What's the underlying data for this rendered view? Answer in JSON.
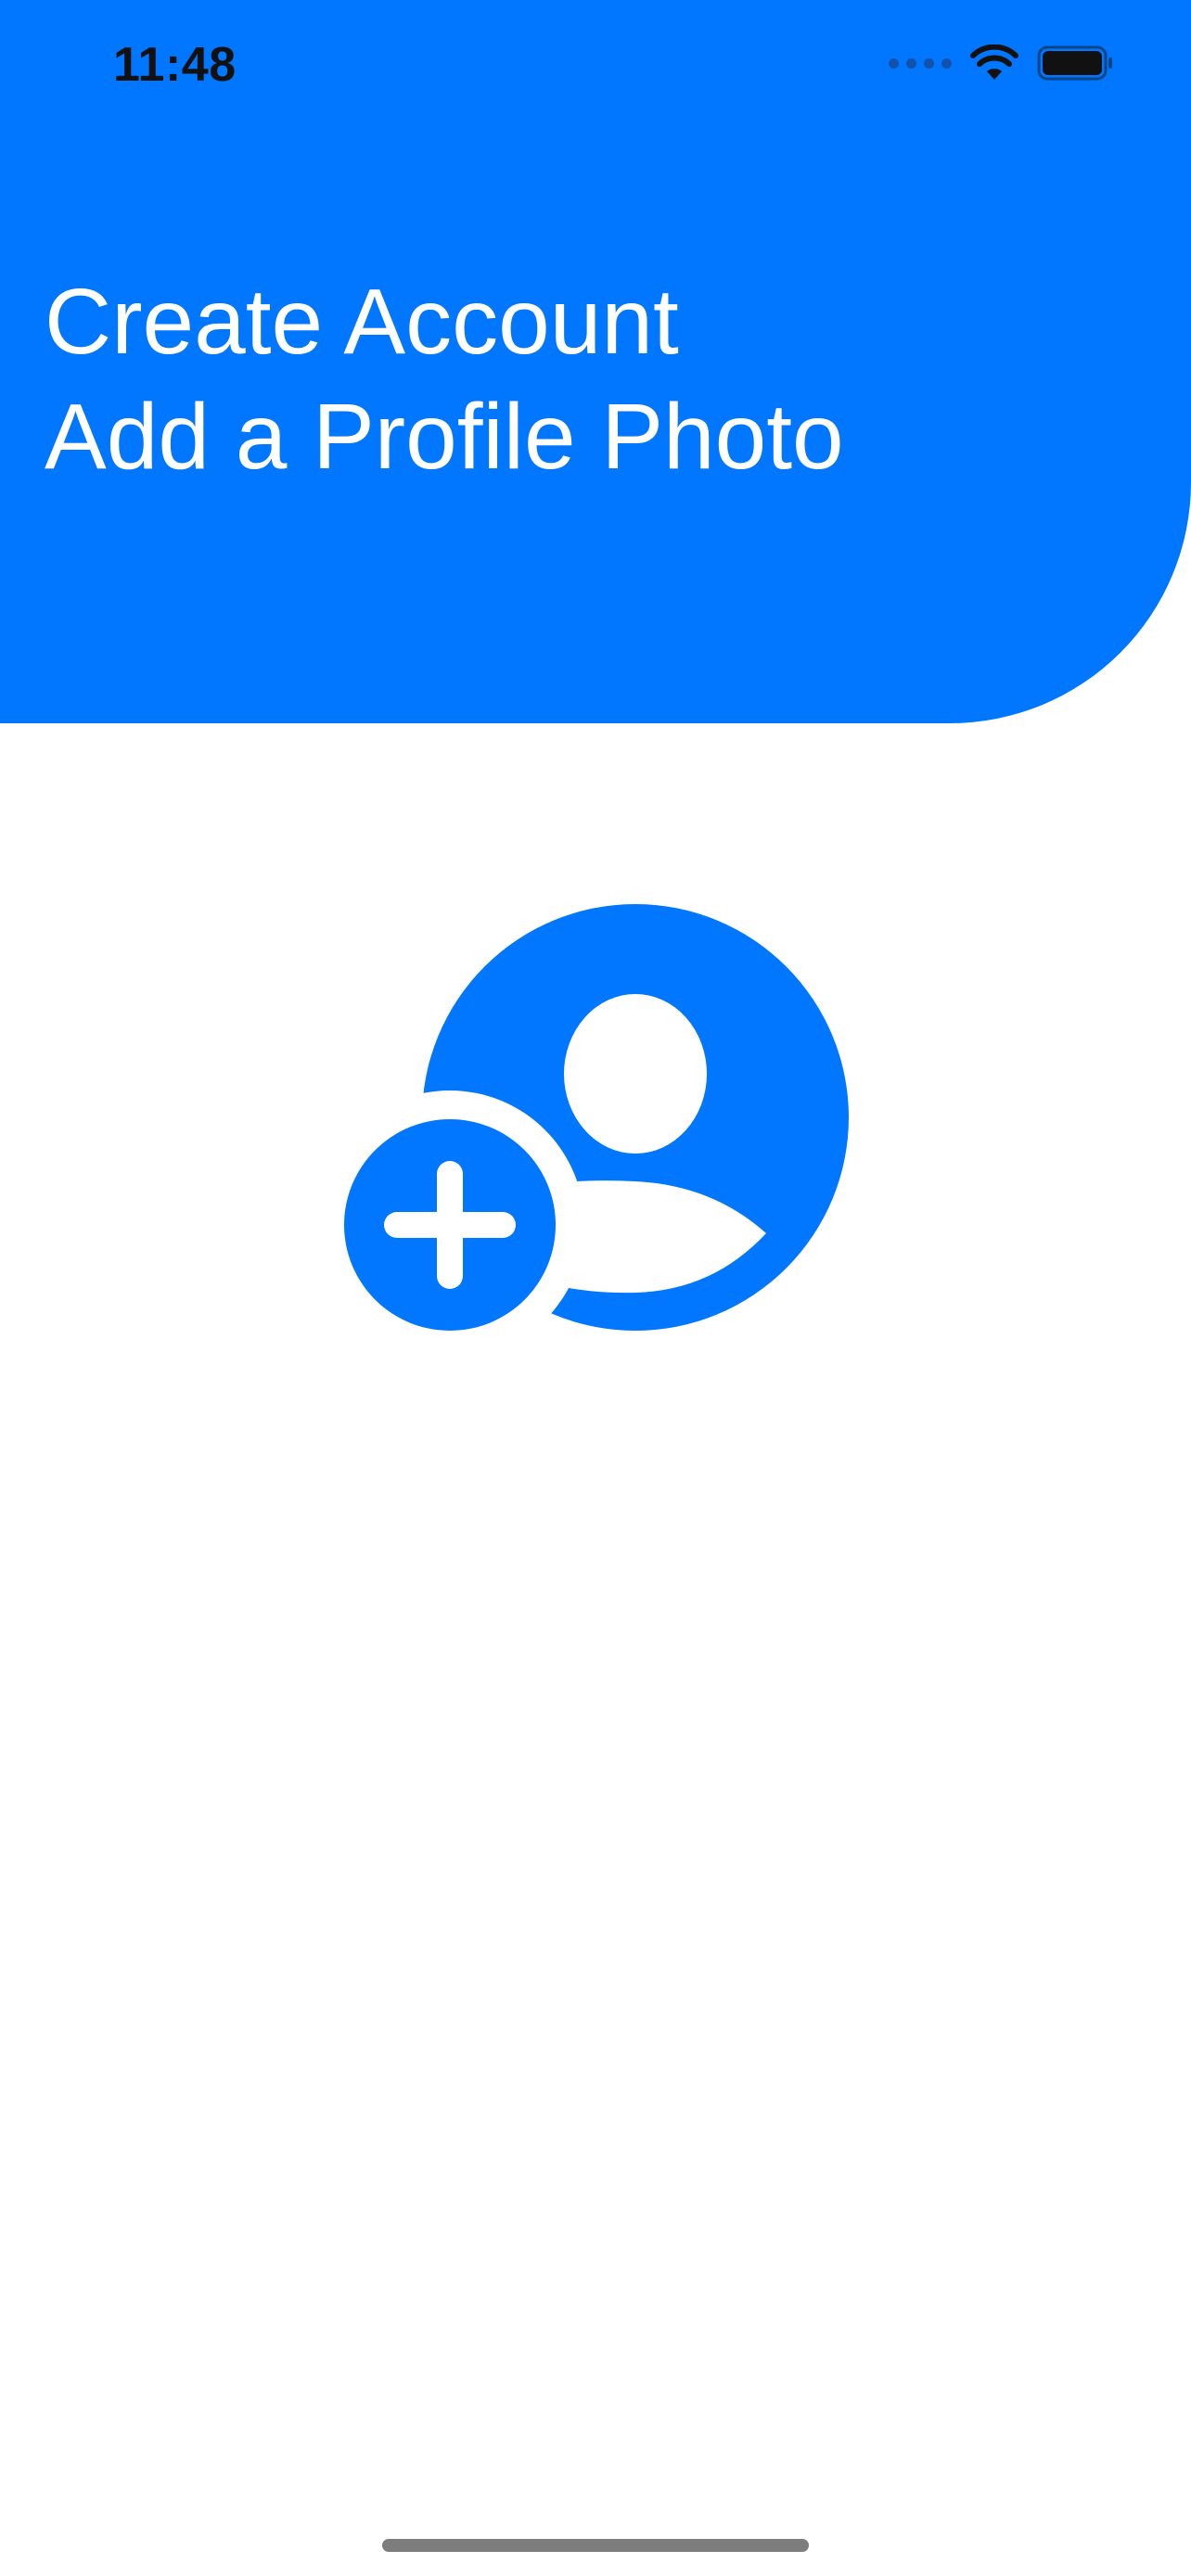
{
  "status_bar": {
    "time": "11:48",
    "icons": [
      "signal-dots-icon",
      "wifi-icon",
      "battery-icon"
    ]
  },
  "header": {
    "title": "Create Account",
    "subtitle": "Add a Profile Photo"
  },
  "profile_photo": {
    "icon": "person-crop-circle-badge-plus-icon"
  },
  "colors": {
    "accent": "#0077FE",
    "background": "#FFFFFF",
    "header_text": "#FFFFFF"
  }
}
